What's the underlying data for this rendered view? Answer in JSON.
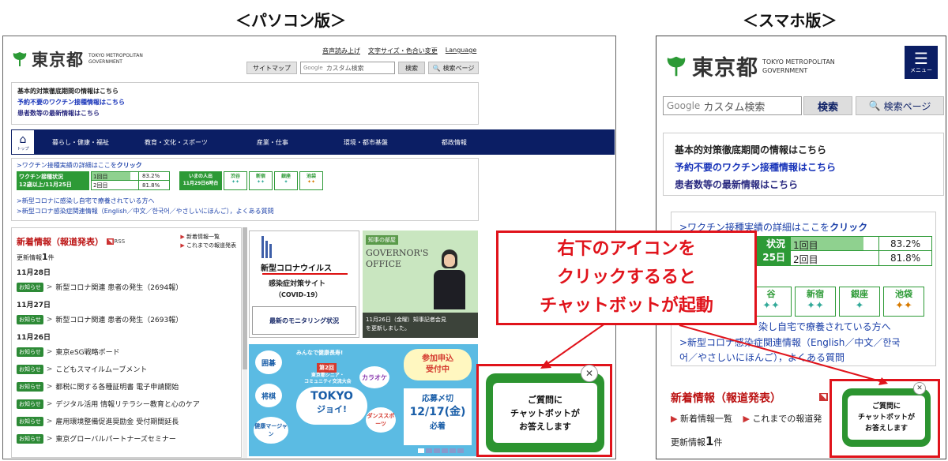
{
  "headings": {
    "pc": "＜パソコン版＞",
    "sp": "＜スマホ版＞"
  },
  "callout": {
    "line1": "右下のアイコンを",
    "line2": "クリックするると",
    "line3": "チャットボットが起動"
  },
  "pc": {
    "logo": "東京都",
    "logo_sub1": "TOKYO METROPOLITAN",
    "logo_sub2": "GOVERNMENT",
    "top_links": [
      "音声読み上げ",
      "文字サイズ・色合い変更",
      "Language"
    ],
    "sitemap": "サイトマップ",
    "search_placeholder": "カスタム検索",
    "search_btn": "検索",
    "search_page": "検索ページ",
    "notice": [
      "基本的対策徹底期間の情報はこちら",
      "予約不要のワクチン接種情報はこちら",
      "患者数等の最新情報はこちら"
    ],
    "nav_home": "トップ",
    "nav": [
      "暮らし・健康・福祉",
      "教育・文化・スポーツ",
      "産業・仕事",
      "環境・都市基盤",
      "都政情報"
    ],
    "vax_link_prefix": ">ワクチン接種実績の詳細はここを",
    "vax_link_click": "クリック",
    "vax_status": "ワクチン接種状況",
    "vax_date": "12歳以上/11月25日",
    "dose1": "1回目",
    "dose1_pct": "83.2%",
    "dose2": "2回目",
    "dose2_pct": "81.8%",
    "people_title": "いまの人出",
    "people_date": "11月29日6時台",
    "places": [
      "渋谷",
      "新宿",
      "銀座",
      "池袋"
    ],
    "links": [
      ">新型コロナに感染し自宅で療養されている方へ",
      ">新型コロナ感染症関連情報（English／中文／한국어／やさしいにほんご），よくある質問"
    ],
    "news_title": "新着情報（報道発表）",
    "rss": "RSS",
    "news_list": "新着情報一覧",
    "news_past": "これまでの報道発表",
    "update_label": "更新情報",
    "update_count": "1",
    "update_unit": "件",
    "tag": "お知らせ",
    "news": [
      {
        "date": "11月28日",
        "items": [
          "新型コロナ関連 患者の発生（2694報）"
        ]
      },
      {
        "date": "11月27日",
        "items": [
          "新型コロナ関連 患者の発生（2693報）"
        ]
      },
      {
        "date": "11月26日",
        "items": [
          "東京eSG戦略ボード",
          "こどもスマイルムーブメント",
          "都税に関する各種証明書 電子申請開始",
          "デジタル活用 情報リテラシー教育と心のケア",
          "雇用環境整備促進奨励金 受付期間延長",
          "東京グローバルパートナーズセミナー"
        ]
      }
    ],
    "covid_title1": "新型コロナウイルス",
    "covid_title2": "感染症対策サイト",
    "covid_sub": "（COVID-19）",
    "monitoring": "最新のモニタリング状況",
    "gov_label": "知事の部屋",
    "gov_office1": "GOVERNOR'S",
    "gov_office2": "OFFICE",
    "gov_caption1": "11月26日（金曜）知事記者会見",
    "gov_caption2": "を更新しました。",
    "banner_top": "みんなで健康長寿!",
    "banner_num": "第2回",
    "banner_sub1": "東京都シニア・",
    "banner_sub2": "コミュニティ交流大会",
    "banner_main": "TOKYO",
    "banner_joy": "ジョイ!",
    "banner_labels": [
      "囲碁",
      "将棋",
      "健康マージャン",
      "カラオケ",
      "ダンススポーツ"
    ],
    "banner_badge1": "参加申込",
    "banner_badge2": "受付中",
    "banner_deadline1": "応募〆切",
    "banner_deadline2": "12/17(金)",
    "banner_deadline3": "必着"
  },
  "chat": {
    "line1": "ご質問に",
    "line2": "チャットボットが",
    "line3": "お答えします",
    "close": "✕"
  },
  "sp": {
    "logo": "東京都",
    "logo_sub1": "TOKYO METROPOLITAN",
    "logo_sub2": "GOVERNMENT",
    "menu": "メニュー",
    "search_placeholder": "カスタム検索",
    "search_btn": "検索",
    "search_page": "検索ページ",
    "notice": [
      "基本的対策徹底期間の情報はこちら",
      "予約不要のワクチン接種情報はこちら",
      "患者数等の最新情報はこちら"
    ],
    "vax_link_prefix": ">ワクチン接種実績の詳細はここを",
    "vax_link_click": "クリック",
    "vax_status": "状況",
    "vax_date": "25日",
    "dose1": "1回目",
    "dose1_pct": "83.2%",
    "dose2": "2回目",
    "dose2_pct": "81.8%",
    "places": [
      "谷",
      "新宿",
      "銀座",
      "池袋"
    ],
    "link1": "染し自宅で療養されている方へ",
    "link2a": ">新型コロナ感染症関連情報（English／中文／한국",
    "link2b": "어／やさしいにほんご），よくある質問",
    "news_title": "新着情報（報道発表）",
    "news_list": "新着情報一覧",
    "news_past": "これまでの報道発",
    "update_label": "更新情報",
    "update_count": "1",
    "update_unit": "件"
  }
}
